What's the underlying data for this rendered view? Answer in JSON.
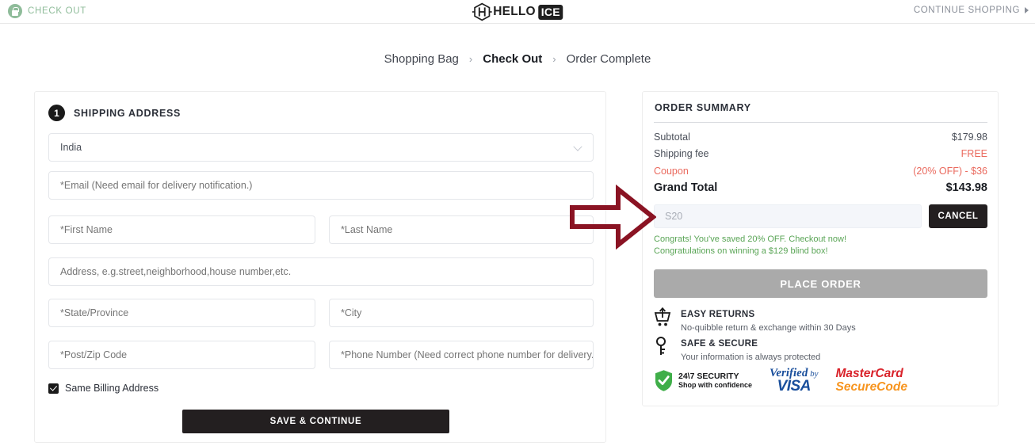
{
  "header": {
    "checkout_label": "CHECK OUT",
    "lock_icon": "lock-icon",
    "logo": {
      "mark": "hexagon-h-logo",
      "hello": "HELLO",
      "ice": "ICE"
    },
    "continue_shopping": "CONTINUE SHOPPING",
    "continue_icon": "chevron-right-icon"
  },
  "breadcrumb": {
    "items": [
      {
        "label": "Shopping Bag",
        "active": false
      },
      {
        "label": "Check Out",
        "active": true
      },
      {
        "label": "Order Complete",
        "active": false
      }
    ],
    "separator": "›"
  },
  "shipping": {
    "step_number": "1",
    "title": "SHIPPING ADDRESS",
    "country": {
      "value": "India",
      "icon": "chevron-down-icon"
    },
    "fields": [
      {
        "name": "email",
        "placeholder": "*Email (Need email for delivery notification.)",
        "value": ""
      },
      {
        "name": "first_name",
        "placeholder": "*First Name",
        "value": ""
      },
      {
        "name": "last_name",
        "placeholder": "*Last Name",
        "value": ""
      },
      {
        "name": "address",
        "placeholder": "Address, e.g.street,neighborhood,house number,etc.",
        "value": ""
      },
      {
        "name": "state",
        "placeholder": "*State/Province",
        "value": ""
      },
      {
        "name": "city",
        "placeholder": "*City",
        "value": ""
      },
      {
        "name": "zip",
        "placeholder": "*Post/Zip Code",
        "value": ""
      },
      {
        "name": "phone",
        "placeholder": "*Phone Number (Need correct phone number for delivery.)",
        "value": ""
      }
    ],
    "billing_checkbox": {
      "label": "Same Billing Address",
      "checked": true,
      "icon": "checkbox-checked-icon"
    },
    "save_button": "SAVE & CONTINUE"
  },
  "order_summary": {
    "title": "ORDER SUMMARY",
    "rows": [
      {
        "label": "Subtotal",
        "value": "$179.98",
        "label_red": false,
        "value_red": false
      },
      {
        "label": "Shipping fee",
        "value": "FREE",
        "label_red": false,
        "value_red": true
      },
      {
        "label": "Coupon",
        "value": "(20% OFF) - $36",
        "label_red": true,
        "value_red": true
      },
      {
        "label": "Grand Total",
        "value": "$143.98",
        "label_red": false,
        "value_red": false
      }
    ],
    "coupon": {
      "placeholder": "S20",
      "value": "",
      "cancel_label": "CANCEL"
    },
    "congrats": [
      "Congrats! You've saved 20% OFF. Checkout now!",
      "Congratulations on winning a $129 blind box!"
    ],
    "place_order": "PLACE ORDER",
    "perks": [
      {
        "icon": "cart-return-icon",
        "title": "EASY RETURNS",
        "sub": "No-quibble return & exchange within 30 Days"
      },
      {
        "icon": "key-icon",
        "title": "SAFE & SECURE",
        "sub": "Your information is always protected"
      }
    ],
    "badges": {
      "security": {
        "icon": "green-shield-check-icon",
        "line1": "24\\7 SECURITY",
        "line2": "Shop with confidence"
      },
      "visa": {
        "line1": "Verified",
        "by": " by",
        "line2": "VISA"
      },
      "mastercard": {
        "line1": "MasterCard",
        "line2": "SecureCode"
      }
    }
  },
  "annotation": {
    "arrow_icon": "right-arrow-annotation",
    "color": "#8a1323"
  },
  "colors": {
    "accent_red": "#ea6a5e",
    "green_text": "#5aa556",
    "dark_button": "#231f20",
    "disabled_button": "#aaaaaa",
    "header_green": "#8fbc9a"
  }
}
